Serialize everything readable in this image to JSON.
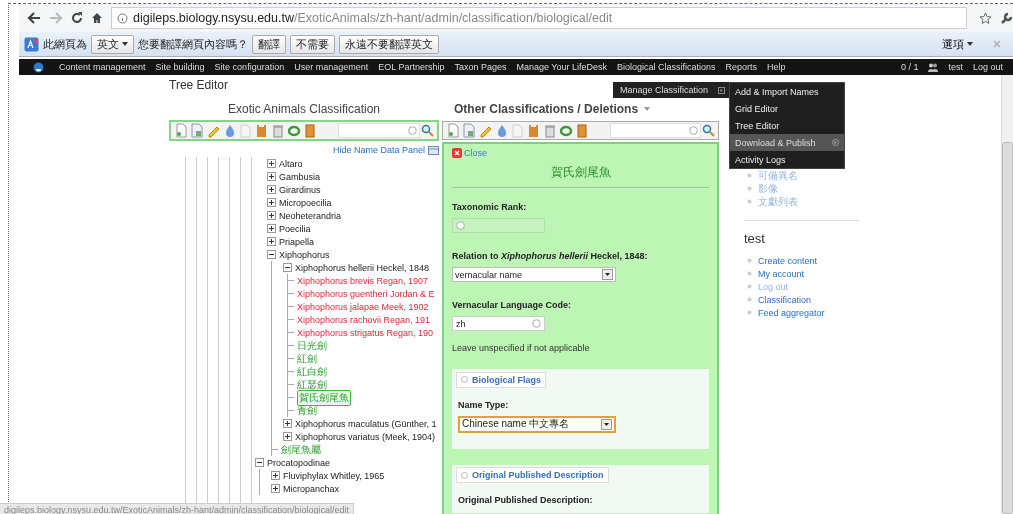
{
  "browser": {
    "url_host": "digileps.biology.nsysu.edu.tw",
    "url_path": "/ExoticAnimals/zh-hant/admin/classification/biological/edit"
  },
  "translate_bar": {
    "prefix": "此網頁為",
    "language": "英文",
    "question": "您要翻譯網頁內容嗎？",
    "buttons": [
      "翻譯",
      "不需要",
      "永遠不要翻譯英文"
    ],
    "options": "選項"
  },
  "admin_menu": {
    "items": [
      "Content management",
      "Site building",
      "Site configuration",
      "User management",
      "EOL Partnership",
      "Taxon Pages",
      "Manage Your LifeDesk",
      "Biological Classifications",
      "Reports",
      "Help"
    ],
    "counter": "0 / 1",
    "user": "test",
    "logout": "Log out"
  },
  "dropdown": {
    "parent": "Manage Classification",
    "items": [
      {
        "label": "Add & Import Names",
        "selected": false,
        "submenu": false
      },
      {
        "label": "Grid Editor",
        "selected": false,
        "submenu": false
      },
      {
        "label": "Tree Editor",
        "selected": false,
        "submenu": false
      },
      {
        "label": "Download & Publish",
        "selected": true,
        "submenu": true
      },
      {
        "label": "Activity Logs",
        "selected": false,
        "submenu": false
      }
    ]
  },
  "page_title": "Tree Editor",
  "left": {
    "title": "Exotic Animals Classification",
    "hide_link": "Hide Name Data Panel",
    "tree": [
      {
        "children": [
          {
            "label": "Altaro",
            "kind": "taxon",
            "expanded": false,
            "selected": false
          },
          {
            "label": "Gambusia",
            "kind": "taxon",
            "expanded": false,
            "selected": false
          },
          {
            "label": "Girardinus",
            "kind": "taxon",
            "expanded": false,
            "selected": false
          },
          {
            "label": "Micropoecilia",
            "kind": "taxon",
            "expanded": false,
            "selected": false
          },
          {
            "label": "Neoheterandria",
            "kind": "taxon",
            "expanded": false,
            "selected": false
          },
          {
            "label": "Poecilia",
            "kind": "taxon",
            "expanded": false,
            "selected": false
          },
          {
            "label": "Priapella",
            "kind": "taxon",
            "expanded": false,
            "selected": false
          },
          {
            "label": "Xiphophorus",
            "kind": "taxon",
            "expanded": true,
            "selected": false,
            "children": [
              {
                "label": "Xiphophorus hellerii Heckel, 1848",
                "kind": "taxon",
                "expanded": true,
                "selected": false,
                "children": [
                  {
                    "label": "Xiphophorus brevis Regan, 1907",
                    "kind": "synonym",
                    "selected": false
                  },
                  {
                    "label": "Xiphophorus guentheri Jordan & E",
                    "kind": "synonym",
                    "selected": false
                  },
                  {
                    "label": "Xiphophorus jalapae Meek, 1902",
                    "kind": "synonym",
                    "selected": false
                  },
                  {
                    "label": "Xiphophorus rachovii Regan, 191",
                    "kind": "synonym",
                    "selected": false
                  },
                  {
                    "label": "Xiphophorus strigatus Regan, 190",
                    "kind": "synonym",
                    "selected": false
                  },
                  {
                    "label": "日光劍",
                    "kind": "vernacular",
                    "selected": false
                  },
                  {
                    "label": "紅劍",
                    "kind": "vernacular",
                    "selected": false
                  },
                  {
                    "label": "紅白劍",
                    "kind": "vernacular",
                    "selected": false
                  },
                  {
                    "label": "紅瑟劍",
                    "kind": "vernacular",
                    "selected": false
                  },
                  {
                    "label": "賀氏劍尾魚",
                    "kind": "vernacular",
                    "selected": true
                  },
                  {
                    "label": "青劍",
                    "kind": "vernacular",
                    "selected": false
                  }
                ]
              },
              {
                "label": "Xiphophorus maculatus (Günther, 1",
                "kind": "taxon",
                "expanded": false,
                "selected": false
              },
              {
                "label": "Xiphophorus variatus (Meek, 1904)",
                "kind": "taxon",
                "expanded": false,
                "selected": false
              },
              {
                "label": "劍尾魚屬",
                "kind": "vernacular",
                "selected": false
              }
            ]
          }
        ]
      },
      {
        "label": "Procatopodinae",
        "kind": "taxon",
        "expanded": true,
        "selected": false,
        "children": [
          {
            "label": "Fluviphylax Whitley, 1965",
            "kind": "taxon",
            "expanded": false,
            "selected": false
          },
          {
            "label": "Micropanchax",
            "kind": "taxon",
            "expanded": false,
            "selected": false
          }
        ]
      }
    ]
  },
  "right": {
    "title": "Other Classifications / Deletions",
    "panel": {
      "close": "Close",
      "title": "賀氏劍尾魚",
      "fields": [
        {
          "kind": "field",
          "label": "Taxonomic Rank:",
          "disabled": true
        },
        {
          "kind": "select",
          "label": "Relation to *Xiphophorus hellerii* Heckel, 1848:",
          "value": "vernacular name",
          "focused": false
        },
        {
          "kind": "field",
          "label": "Vernacular Language Code:",
          "value": "zh",
          "disabled": false
        },
        {
          "kind": "note",
          "text": "Leave unspecified if not applicable"
        },
        {
          "kind": "fieldset",
          "legend": "Biological Flags",
          "children": [
            {
              "kind": "select",
              "label": "Name Type:",
              "value": "Chinese name 中文專名",
              "focused": true
            }
          ]
        },
        {
          "kind": "fieldset",
          "legend": "Original Published Description",
          "children": [
            {
              "kind": "label",
              "label": "Original Published Description:"
            }
          ]
        }
      ]
    }
  },
  "sidebar": {
    "top_links": [
      {
        "label": "可備異名",
        "dimmed": true
      },
      {
        "label": "影像",
        "dimmed": true
      },
      {
        "label": "文獻列表",
        "dimmed": true
      }
    ],
    "heading": "test",
    "links": [
      {
        "label": "Create content",
        "dimmed": false
      },
      {
        "label": "My account",
        "dimmed": false
      },
      {
        "label": "Log out",
        "dimmed": true
      },
      {
        "label": "Classification",
        "dimmed": false
      },
      {
        "label": "Feed aggregator",
        "dimmed": false
      }
    ]
  },
  "status_bar": "digileps.biology.nsysu.edu.tw/ExoticAnimals/zh-hant/admin/classification/biological/edit"
}
